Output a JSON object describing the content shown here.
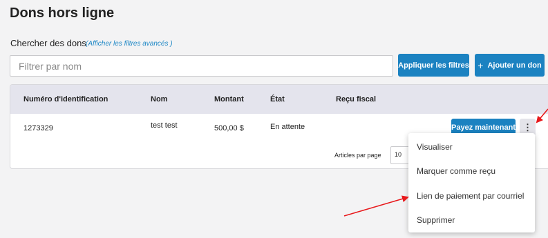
{
  "page": {
    "title": "Dons hors ligne"
  },
  "search": {
    "label": "Chercher des dons",
    "advanced_link": "(Afficher les filtres avancés )",
    "placeholder": "Filtrer par nom",
    "apply_label": "Appliquer les filtres",
    "add_label": "Ajouter un don"
  },
  "table": {
    "columns": [
      "Numéro d'identification",
      "Nom",
      "Montant",
      "État",
      "Reçu fiscal"
    ],
    "rows": [
      {
        "id": "1273329",
        "name": "test test",
        "amount": "500,00 $",
        "status": "En attente",
        "receipt": ""
      }
    ],
    "pay_label": "Payez maintenant",
    "kebab_icon": "⋮",
    "per_page_label": "Articles par page",
    "per_page_value": "10"
  },
  "menu": {
    "items": [
      "Visualiser",
      "Marquer comme reçu",
      "Lien de paiement par courriel",
      "Supprimer"
    ]
  },
  "colors": {
    "accent": "#1b82c1",
    "annotation": "#e8191c",
    "header_bg": "#e4e4ed"
  }
}
